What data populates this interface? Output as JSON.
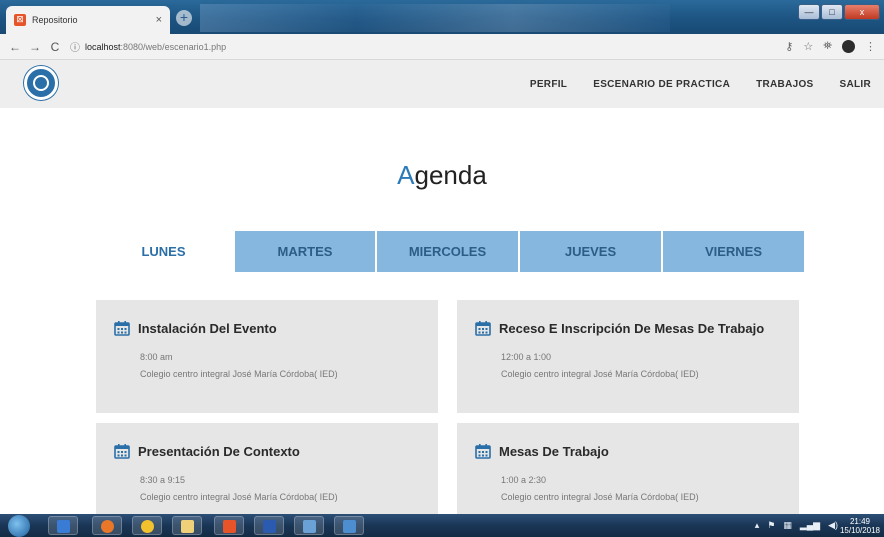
{
  "browser": {
    "tab_title": "Repositorio",
    "tab_close": "×",
    "new_tab": "+",
    "url_host": "localhost",
    "url_path": ":8080/web/escenario1.php",
    "window_controls": {
      "minimize": "—",
      "maximize": "□",
      "close": "x"
    },
    "icons": [
      "back-arrow-icon",
      "forward-arrow-icon",
      "reload-icon",
      "info-icon",
      "key-icon",
      "star-icon",
      "extension-icon",
      "profile-icon",
      "menu-icon"
    ]
  },
  "site_nav": {
    "links": [
      "PERFIL",
      "ESCENARIO DE PRACTICA",
      "TRABAJOS",
      "SALIR"
    ]
  },
  "agenda": {
    "title_first": "A",
    "title_rest": "genda",
    "days": [
      "LUNES",
      "MARTES",
      "MIERCOLES",
      "JUEVES",
      "VIERNES"
    ],
    "active_day": "LUNES",
    "events": [
      {
        "title": "Instalación Del Evento",
        "time": "8:00 am",
        "place": "Colegio centro integral José María Córdoba( IED)"
      },
      {
        "title": "Receso E Inscripción De Mesas De Trabajo",
        "time": "12:00 a 1:00",
        "place": "Colegio centro integral José María Córdoba( IED)"
      },
      {
        "title": "Presentación De Contexto",
        "time": "8:30 a 9:15",
        "place": "Colegio centro integral José María Córdoba( IED)"
      },
      {
        "title": "Mesas De Trabajo",
        "time": "1:00 a 2:30",
        "place": "Colegio centro integral José María Córdoba( IED)"
      }
    ]
  },
  "taskbar": {
    "time": "21:49",
    "date": "15/10/2018"
  },
  "colors": {
    "accent": "#2b6fa8",
    "tab_inactive": "#86b7de",
    "card_bg": "#e6e6e6",
    "nav_bg": "#eeeeee"
  }
}
